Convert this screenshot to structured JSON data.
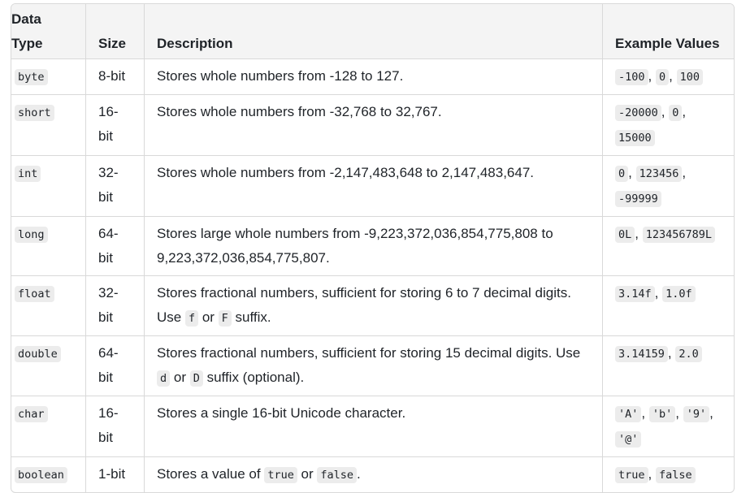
{
  "headers": [
    "Data Type",
    "Size",
    "Description",
    "Example Values"
  ],
  "rows": [
    {
      "type": "byte",
      "size": "8-bit",
      "desc": [
        {
          "t": "Stores whole numbers from -128 to 127."
        }
      ],
      "examples": [
        "-100",
        "0",
        "100"
      ]
    },
    {
      "type": "short",
      "size": "16-bit",
      "desc": [
        {
          "t": "Stores whole numbers from -32,768 to 32,767."
        }
      ],
      "examples": [
        "-20000",
        "0",
        "15000"
      ]
    },
    {
      "type": "int",
      "size": "32-bit",
      "desc": [
        {
          "t": "Stores whole numbers from -2,147,483,648 to 2,147,483,647."
        }
      ],
      "examples": [
        "0",
        "123456",
        "-99999"
      ]
    },
    {
      "type": "long",
      "size": "64-bit",
      "desc": [
        {
          "t": "Stores large whole numbers from -9,223,372,036,854,775,808 to 9,223,372,036,854,775,807."
        }
      ],
      "examples": [
        "0L",
        "123456789L"
      ]
    },
    {
      "type": "float",
      "size": "32-bit",
      "desc": [
        {
          "t": "Stores fractional numbers, sufficient for storing 6 to 7 decimal digits. Use "
        },
        {
          "c": "f"
        },
        {
          "t": " or "
        },
        {
          "c": "F"
        },
        {
          "t": " suffix."
        }
      ],
      "examples": [
        "3.14f",
        "1.0f"
      ]
    },
    {
      "type": "double",
      "size": "64-bit",
      "desc": [
        {
          "t": "Stores fractional numbers, sufficient for storing 15 decimal digits. Use "
        },
        {
          "c": "d"
        },
        {
          "t": " or "
        },
        {
          "c": "D"
        },
        {
          "t": " suffix (optional)."
        }
      ],
      "examples": [
        "3.14159",
        "2.0"
      ]
    },
    {
      "type": "char",
      "size": "16-bit",
      "desc": [
        {
          "t": "Stores a single 16-bit Unicode character."
        }
      ],
      "examples": [
        "'A'",
        "'b'",
        "'9'",
        "'@'"
      ]
    },
    {
      "type": "boolean",
      "size": "1-bit",
      "desc": [
        {
          "t": "Stores a value of "
        },
        {
          "c": "true"
        },
        {
          "t": " or "
        },
        {
          "c": "false"
        },
        {
          "t": "."
        }
      ],
      "examples": [
        "true",
        "false"
      ]
    }
  ]
}
